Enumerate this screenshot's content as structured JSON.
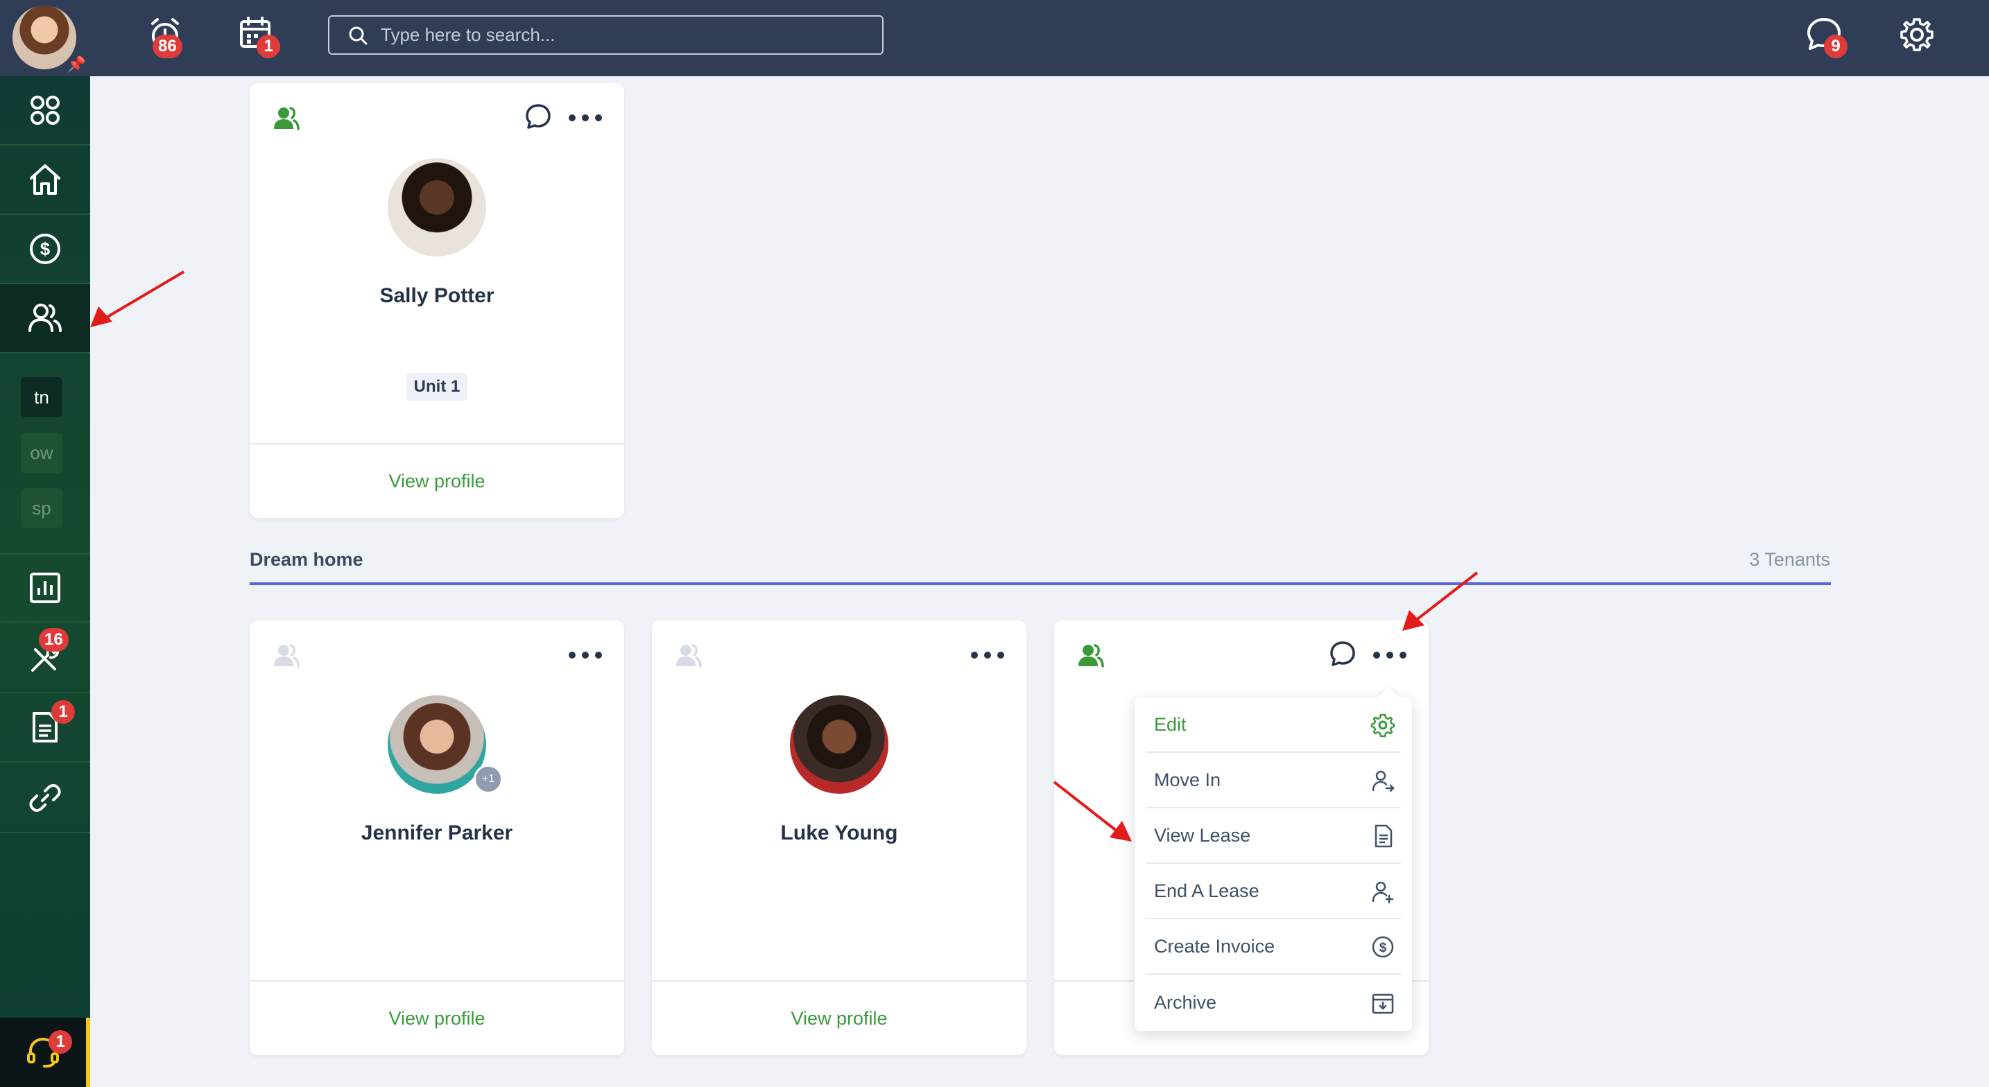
{
  "topbar": {
    "search_placeholder": "Type here to search...",
    "alarm_badge": "86",
    "calendar_badge": "1",
    "messages_badge": "9"
  },
  "sidebar": {
    "chips": [
      "tn",
      "ow",
      "sp"
    ],
    "maintenance_badge": "16",
    "documents_badge": "1",
    "support_badge": "1"
  },
  "top_card": {
    "name": "Sally Potter",
    "unit": "Unit 1",
    "footer_link": "View profile"
  },
  "section": {
    "title": "Dream home",
    "count": "3 Tenants"
  },
  "cards": [
    {
      "name": "Jennifer Parker",
      "extra_badge": "+1",
      "footer_link": "View profile"
    },
    {
      "name": "Luke Young",
      "footer_link": "View profile"
    },
    {
      "name": "",
      "footer_link": ""
    }
  ],
  "menu": {
    "items": [
      "Edit",
      "Move In",
      "View Lease",
      "End A Lease",
      "Create Invoice",
      "Archive"
    ]
  },
  "colors": {
    "topbar": "#2f3e56",
    "accent_green": "#3a9a3a",
    "badge_red": "#e03b3b",
    "section_rule": "#5863e0",
    "annotation_red": "#e21b1b"
  }
}
